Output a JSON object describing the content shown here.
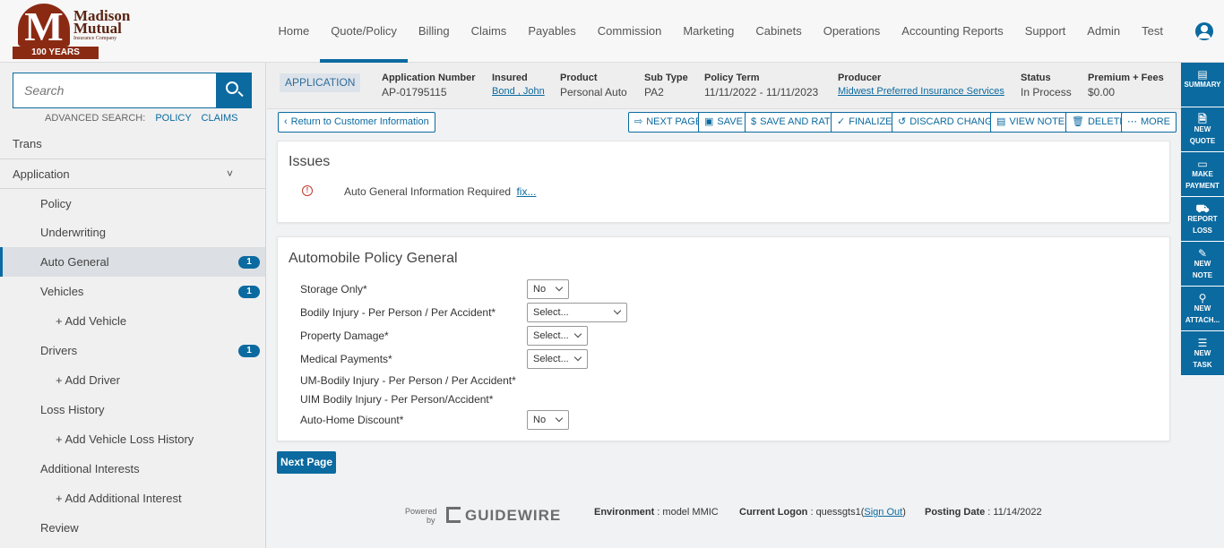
{
  "header": {
    "logo": {
      "line1": "Madison",
      "line2": "Mutual",
      "line3": "Insurance Company",
      "ribbon": "100 YEARS",
      "initial": "M"
    },
    "nav": [
      "Home",
      "Quote/Policy",
      "Billing",
      "Claims",
      "Payables",
      "Commission",
      "Marketing",
      "Cabinets",
      "Operations",
      "Accounting Reports",
      "Support",
      "Admin",
      "Test"
    ],
    "active_nav": "Quote/Policy"
  },
  "sidebar": {
    "search_placeholder": "Search",
    "advanced_label": "ADVANCED SEARCH:",
    "advanced_links": [
      "POLICY",
      "CLAIMS"
    ],
    "items": [
      {
        "label": "Trans",
        "level": 0
      },
      {
        "label": "Application",
        "level": 0,
        "chevron": "˅"
      },
      {
        "label": "Policy",
        "level": 1
      },
      {
        "label": "Underwriting",
        "level": 1
      },
      {
        "label": "Auto General",
        "level": 1,
        "badge": "1",
        "selected": true
      },
      {
        "label": "Vehicles",
        "level": 1,
        "badge": "1"
      },
      {
        "label": "+ Add Vehicle",
        "level": 2
      },
      {
        "label": "Drivers",
        "level": 1,
        "badge": "1"
      },
      {
        "label": "+ Add Driver",
        "level": 2
      },
      {
        "label": "Loss History",
        "level": 1
      },
      {
        "label": "+ Add Vehicle Loss History",
        "level": 2
      },
      {
        "label": "Additional Interests",
        "level": 1
      },
      {
        "label": "+ Add Additional Interest",
        "level": 2
      },
      {
        "label": "Review",
        "level": 1
      }
    ]
  },
  "infobar": {
    "tag": "APPLICATION",
    "app_number": {
      "label": "Application Number",
      "value": "AP-01795115"
    },
    "insured": {
      "label": "Insured",
      "value": "Bond , John"
    },
    "product": {
      "label": "Product",
      "value": "Personal Auto"
    },
    "subtype": {
      "label": "Sub Type",
      "value": "PA2"
    },
    "term": {
      "label": "Policy Term",
      "value": "11/11/2022 - 11/11/2023"
    },
    "producer": {
      "label": "Producer",
      "value": "Midwest Preferred Insurance Services"
    },
    "status": {
      "label": "Status",
      "value": "In Process"
    },
    "premium": {
      "label": "Premium + Fees",
      "value": "$0.00"
    }
  },
  "toolbar": {
    "return_label": "Return to Customer Information",
    "next_page": "NEXT PAGE",
    "save": "SAVE",
    "save_rate": "SAVE AND RATE",
    "finalize": "FINALIZE",
    "discard": "DISCARD CHANGES",
    "view_notes": "VIEW NOTES",
    "delete": "DELETE",
    "more": "MORE"
  },
  "issues": {
    "title": "Issues",
    "text": "Auto General Information Required",
    "fix": "fix..."
  },
  "form": {
    "title": "Automobile Policy General",
    "fields": [
      {
        "label": "Storage Only*",
        "value": "No"
      },
      {
        "label": "Bodily Injury - Per Person / Per Accident*",
        "value": "Select..."
      },
      {
        "label": "Property Damage*",
        "value": "Select..."
      },
      {
        "label": "Medical Payments*",
        "value": "Select..."
      },
      {
        "label": "UM-Bodily Injury - Per Person / Per Accident*"
      },
      {
        "label": "UIM Bodily Injury - Per Person/Accident*"
      },
      {
        "label": "Auto-Home Discount*",
        "value": "No"
      }
    ],
    "next_page": "Next Page"
  },
  "footer": {
    "powered": "Powered",
    "by": "by",
    "brand": "GUIDEWIRE",
    "env_label": "Environment",
    "env_value": ": model MMIC",
    "logon_label": "Current Logon",
    "logon_user": ": quessgts1(",
    "sign_out": "Sign Out",
    "logon_close": ")",
    "posting_label": "Posting Date",
    "posting_value": ": 11/14/2022"
  },
  "rail": [
    {
      "icon": "summary-icon",
      "glyph": "▤",
      "line1": "SUMMARY",
      "line2": ""
    },
    {
      "icon": "new-quote-icon",
      "glyph": "🗎",
      "line1": "NEW",
      "line2": "QUOTE"
    },
    {
      "icon": "make-payment-icon",
      "glyph": "▭",
      "line1": "MAKE",
      "line2": "PAYMENT"
    },
    {
      "icon": "report-loss-icon",
      "glyph": "⛟",
      "line1": "REPORT",
      "line2": "LOSS"
    },
    {
      "icon": "new-note-icon",
      "glyph": "✎",
      "line1": "NEW",
      "line2": "NOTE"
    },
    {
      "icon": "new-attachment-icon",
      "glyph": "⚲",
      "line1": "NEW",
      "line2": "ATTACH..."
    },
    {
      "icon": "new-task-icon",
      "glyph": "☰",
      "line1": "NEW",
      "line2": "TASK"
    }
  ]
}
